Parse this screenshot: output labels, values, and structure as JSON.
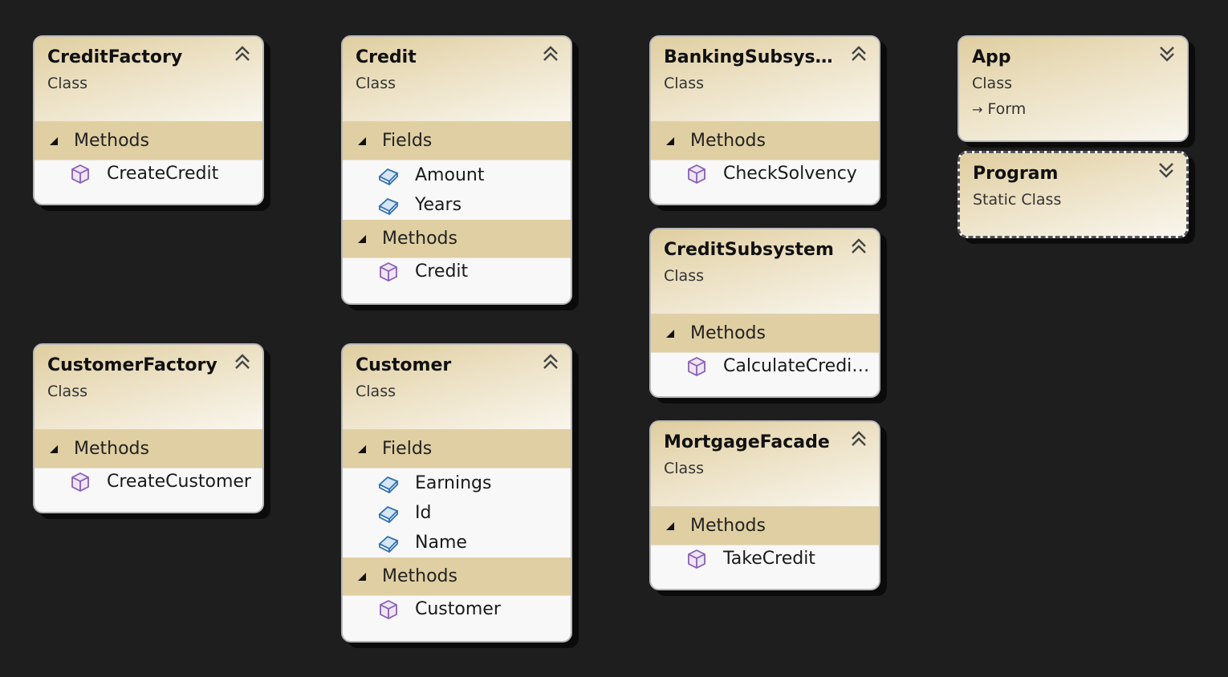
{
  "shapes": {
    "credit_factory": {
      "title": "CreditFactory",
      "kind": "Class",
      "methods_label": "Methods",
      "methods": [
        "CreateCredit"
      ]
    },
    "credit": {
      "title": "Credit",
      "kind": "Class",
      "fields_label": "Fields",
      "fields": [
        "Amount",
        "Years"
      ],
      "methods_label": "Methods",
      "methods": [
        "Credit"
      ]
    },
    "banking_subsystem": {
      "title": "BankingSubsyst...",
      "kind": "Class",
      "methods_label": "Methods",
      "methods": [
        "CheckSolvency"
      ]
    },
    "app": {
      "title": "App",
      "kind": "Class",
      "base_type": "Form"
    },
    "program": {
      "title": "Program",
      "kind": "Static Class"
    },
    "credit_subsystem": {
      "title": "CreditSubsystem",
      "kind": "Class",
      "methods_label": "Methods",
      "methods": [
        "CalculateCredit..."
      ]
    },
    "customer_factory": {
      "title": "CustomerFactory",
      "kind": "Class",
      "methods_label": "Methods",
      "methods": [
        "CreateCustomer"
      ]
    },
    "customer": {
      "title": "Customer",
      "kind": "Class",
      "fields_label": "Fields",
      "fields": [
        "Earnings",
        "Id",
        "Name"
      ],
      "methods_label": "Methods",
      "methods": [
        "Customer"
      ]
    },
    "mortgage_facade": {
      "title": "MortgageFacade",
      "kind": "Class",
      "methods_label": "Methods",
      "methods": [
        "TakeCredit"
      ]
    }
  },
  "colors": {
    "canvas": "#1e1e1e",
    "header_gold": "#e0cea0",
    "section_band": "#e0cfa2",
    "method_icon": "#8a5fb5",
    "field_icon": "#2f6fb3"
  }
}
